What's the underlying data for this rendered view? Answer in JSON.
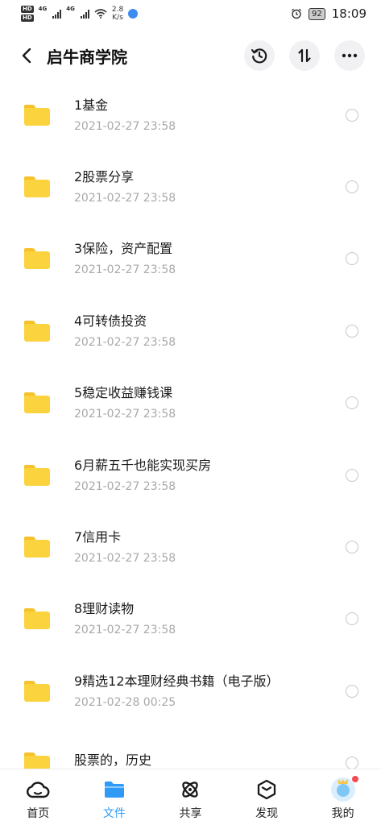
{
  "status_bar": {
    "net1": "4G",
    "net2": "4G",
    "speed_value": "2.8",
    "speed_unit": "K/s",
    "battery": "92",
    "time": "18:09"
  },
  "header": {
    "title": "启牛商学院",
    "icons": [
      "back-icon",
      "history-icon",
      "sort-icon",
      "more-icon"
    ]
  },
  "files": [
    {
      "name": "1基金",
      "date": "2021-02-27  23:58"
    },
    {
      "name": "2股票分享",
      "date": "2021-02-27  23:58"
    },
    {
      "name": "3保险，资产配置",
      "date": "2021-02-27  23:58"
    },
    {
      "name": "4可转债投资",
      "date": "2021-02-27  23:58"
    },
    {
      "name": "5稳定收益赚钱课",
      "date": "2021-02-27  23:58"
    },
    {
      "name": "6月薪五千也能实现买房",
      "date": "2021-02-27  23:58"
    },
    {
      "name": "7信用卡",
      "date": "2021-02-27  23:58"
    },
    {
      "name": "8理财读物",
      "date": "2021-02-27  23:58"
    },
    {
      "name": "9精选12本理财经典书籍（电子版）",
      "date": "2021-02-28  00:25"
    },
    {
      "name": "股票的，历史",
      "date": ""
    }
  ],
  "tabbar": {
    "active_color": "#2f9bf7",
    "tabs": [
      {
        "label": "首页",
        "icon": "cloud-icon"
      },
      {
        "label": "文件",
        "icon": "folder-icon"
      },
      {
        "label": "共享",
        "icon": "share-icon"
      },
      {
        "label": "发现",
        "icon": "discover-icon"
      },
      {
        "label": "我的",
        "icon": "avatar-icon"
      }
    ]
  }
}
